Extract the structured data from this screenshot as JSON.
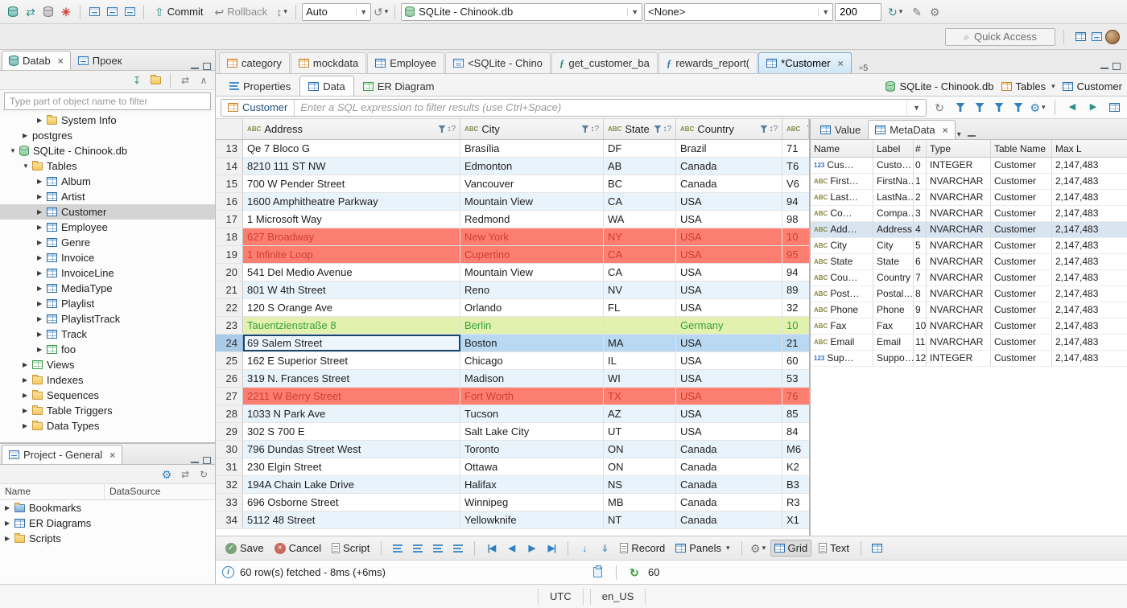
{
  "topbar": {
    "commit_label": "Commit",
    "rollback_label": "Rollback",
    "auto_value": "Auto",
    "datasource_value": "SQLite - Chinook.db",
    "schema_value": "<None>",
    "fetch_size": "200",
    "quick_access_label": "Quick Access"
  },
  "navigator": {
    "tab_database": "Datab",
    "tab_projects": "Проек",
    "filter_placeholder": "Type part of object name to filter",
    "tree": [
      {
        "label": "System Info",
        "indent": 46,
        "icon": "folder",
        "exp": "closed"
      },
      {
        "label": "postgres",
        "indent": 28,
        "icon": "none",
        "exp": "closed"
      },
      {
        "label": "SQLite - Chinook.db",
        "indent": 12,
        "icon": "db-green",
        "exp": "open"
      },
      {
        "label": "Tables",
        "indent": 28,
        "icon": "folder",
        "exp": "open"
      },
      {
        "label": "Album",
        "indent": 46,
        "icon": "table-blue",
        "exp": "closed"
      },
      {
        "label": "Artist",
        "indent": 46,
        "icon": "table-blue",
        "exp": "closed"
      },
      {
        "label": "Customer",
        "indent": 46,
        "icon": "table-blue",
        "exp": "closed",
        "selected": true
      },
      {
        "label": "Employee",
        "indent": 46,
        "icon": "table-blue",
        "exp": "closed"
      },
      {
        "label": "Genre",
        "indent": 46,
        "icon": "table-blue",
        "exp": "closed"
      },
      {
        "label": "Invoice",
        "indent": 46,
        "icon": "table-blue",
        "exp": "closed"
      },
      {
        "label": "InvoiceLine",
        "indent": 46,
        "icon": "table-blue",
        "exp": "closed"
      },
      {
        "label": "MediaType",
        "indent": 46,
        "icon": "table-blue",
        "exp": "closed"
      },
      {
        "label": "Playlist",
        "indent": 46,
        "icon": "table-blue",
        "exp": "closed"
      },
      {
        "label": "PlaylistTrack",
        "indent": 46,
        "icon": "table-blue",
        "exp": "closed"
      },
      {
        "label": "Track",
        "indent": 46,
        "icon": "table-blue",
        "exp": "closed"
      },
      {
        "label": "foo",
        "indent": 46,
        "icon": "table-green",
        "exp": "closed"
      },
      {
        "label": "Views",
        "indent": 28,
        "icon": "table-green",
        "exp": "closed"
      },
      {
        "label": "Indexes",
        "indent": 28,
        "icon": "folder",
        "exp": "closed"
      },
      {
        "label": "Sequences",
        "indent": 28,
        "icon": "folder",
        "exp": "closed"
      },
      {
        "label": "Table Triggers",
        "indent": 28,
        "icon": "folder",
        "exp": "closed"
      },
      {
        "label": "Data Types",
        "indent": 28,
        "icon": "folder",
        "exp": "closed"
      }
    ]
  },
  "project_panel": {
    "title": "Project - General",
    "col_name": "Name",
    "col_datasource": "DataSource",
    "items": [
      {
        "label": "Bookmarks",
        "icon": "folder-blue"
      },
      {
        "label": "ER Diagrams",
        "icon": "table-blue"
      },
      {
        "label": "Scripts",
        "icon": "folder"
      }
    ]
  },
  "editor": {
    "tabs": [
      {
        "label": "category",
        "icon": "table-orange"
      },
      {
        "label": "mockdata",
        "icon": "table-orange"
      },
      {
        "label": "Employee",
        "icon": "table-blue"
      },
      {
        "label": "<SQLite - Chino",
        "icon": "sql"
      },
      {
        "label": "get_customer_ba",
        "icon": "proc-teal"
      },
      {
        "label": "rewards_report(",
        "icon": "proc-blue"
      },
      {
        "label": "*Customer",
        "icon": "table-blue",
        "active": true,
        "close": true
      }
    ],
    "tab_overflow_count": "5",
    "subtabs": [
      {
        "label": "Properties"
      },
      {
        "label": "Data",
        "active": true
      },
      {
        "label": "ER Diagram"
      }
    ],
    "breadcrumb": {
      "datasource": "SQLite - Chinook.db",
      "container": "Tables",
      "entity": "Customer"
    },
    "filter": {
      "entity": "Customer",
      "placeholder": "Enter a SQL expression to filter results (use Ctrl+Space)"
    }
  },
  "grid": {
    "sort_hint": "↕?",
    "columns": [
      {
        "label": "Address"
      },
      {
        "label": "City"
      },
      {
        "label": "State"
      },
      {
        "label": "Country"
      },
      {
        "label": ""
      }
    ],
    "rows": [
      {
        "num": "13",
        "address": "Qe 7 Bloco G",
        "city": "Brasília",
        "state": "DF",
        "country": "Brazil",
        "postal": "71",
        "style": "w"
      },
      {
        "num": "14",
        "address": "8210 111 ST NW",
        "city": "Edmonton",
        "state": "AB",
        "country": "Canada",
        "postal": "T6",
        "style": "a"
      },
      {
        "num": "15",
        "address": "700 W Pender Street",
        "city": "Vancouver",
        "state": "BC",
        "country": "Canada",
        "postal": "V6",
        "style": "w"
      },
      {
        "num": "16",
        "address": "1600 Amphitheatre Parkway",
        "city": "Mountain View",
        "state": "CA",
        "country": "USA",
        "postal": "94",
        "style": "a"
      },
      {
        "num": "17",
        "address": "1 Microsoft Way",
        "city": "Redmond",
        "state": "WA",
        "country": "USA",
        "postal": "98",
        "style": "w"
      },
      {
        "num": "18",
        "address": "627 Broadway",
        "city": "New York",
        "state": "NY",
        "country": "USA",
        "postal": "10",
        "style": "red"
      },
      {
        "num": "19",
        "address": "1 Infinite Loop",
        "city": "Cupertino",
        "state": "CA",
        "country": "USA",
        "postal": "95",
        "style": "red"
      },
      {
        "num": "20",
        "address": "541 Del Medio Avenue",
        "city": "Mountain View",
        "state": "CA",
        "country": "USA",
        "postal": "94",
        "style": "w"
      },
      {
        "num": "21",
        "address": "801 W 4th Street",
        "city": "Reno",
        "state": "NV",
        "country": "USA",
        "postal": "89",
        "style": "a"
      },
      {
        "num": "22",
        "address": "120 S Orange Ave",
        "city": "Orlando",
        "state": "FL",
        "country": "USA",
        "postal": "32",
        "style": "w"
      },
      {
        "num": "23",
        "address": "Tauentzienstraße 8",
        "city": "Berlin",
        "state": "",
        "country": "Germany",
        "postal": "10",
        "style": "green"
      },
      {
        "num": "24",
        "address": "69 Salem Street",
        "city": "Boston",
        "state": "MA",
        "country": "USA",
        "postal": "21",
        "style": "sel",
        "selected_cell": "address"
      },
      {
        "num": "25",
        "address": "162 E Superior Street",
        "city": "Chicago",
        "state": "IL",
        "country": "USA",
        "postal": "60",
        "style": "w"
      },
      {
        "num": "26",
        "address": "319 N. Frances Street",
        "city": "Madison",
        "state": "WI",
        "country": "USA",
        "postal": "53",
        "style": "a"
      },
      {
        "num": "27",
        "address": "2211 W Berry Street",
        "city": "Fort Worth",
        "state": "TX",
        "country": "USA",
        "postal": "76",
        "style": "red"
      },
      {
        "num": "28",
        "address": "1033 N Park Ave",
        "city": "Tucson",
        "state": "AZ",
        "country": "USA",
        "postal": "85",
        "style": "a"
      },
      {
        "num": "29",
        "address": "302 S 700 E",
        "city": "Salt Lake City",
        "state": "UT",
        "country": "USA",
        "postal": "84",
        "style": "w"
      },
      {
        "num": "30",
        "address": "796 Dundas Street West",
        "city": "Toronto",
        "state": "ON",
        "country": "Canada",
        "postal": "M6",
        "style": "a"
      },
      {
        "num": "31",
        "address": "230 Elgin Street",
        "city": "Ottawa",
        "state": "ON",
        "country": "Canada",
        "postal": "K2",
        "style": "w"
      },
      {
        "num": "32",
        "address": "194A Chain Lake Drive",
        "city": "Halifax",
        "state": "NS",
        "country": "Canada",
        "postal": "B3",
        "style": "a"
      },
      {
        "num": "33",
        "address": "696 Osborne Street",
        "city": "Winnipeg",
        "state": "MB",
        "country": "Canada",
        "postal": "R3",
        "style": "w"
      },
      {
        "num": "34",
        "address": "5112 48 Street",
        "city": "Yellowknife",
        "state": "NT",
        "country": "Canada",
        "postal": "X1",
        "style": "a"
      }
    ]
  },
  "meta_panel": {
    "tab_value": "Value",
    "tab_metadata": "MetaData",
    "badges": {
      "abc": "ABC",
      "num": "123"
    },
    "columns": [
      "Name",
      "Label",
      "#",
      "Type",
      "Table Name",
      "Max L"
    ],
    "rows": [
      {
        "kind": "num",
        "name": "Cus…",
        "label": "Custo…",
        "idx": "0",
        "type": "INTEGER",
        "table": "Customer",
        "maxl": "2,147,483"
      },
      {
        "kind": "abc",
        "name": "First…",
        "label": "FirstNa…",
        "idx": "1",
        "type": "NVARCHAR",
        "table": "Customer",
        "maxl": "2,147,483"
      },
      {
        "kind": "abc",
        "name": "Last…",
        "label": "LastNa…",
        "idx": "2",
        "type": "NVARCHAR",
        "table": "Customer",
        "maxl": "2,147,483"
      },
      {
        "kind": "abc",
        "name": "Co…",
        "label": "Compa…",
        "idx": "3",
        "type": "NVARCHAR",
        "table": "Customer",
        "maxl": "2,147,483"
      },
      {
        "kind": "abc",
        "name": "Add…",
        "label": "Address",
        "idx": "4",
        "type": "NVARCHAR",
        "table": "Customer",
        "maxl": "2,147,483",
        "selected": true
      },
      {
        "kind": "abc",
        "name": "City",
        "label": "City",
        "idx": "5",
        "type": "NVARCHAR",
        "table": "Customer",
        "maxl": "2,147,483"
      },
      {
        "kind": "abc",
        "name": "State",
        "label": "State",
        "idx": "6",
        "type": "NVARCHAR",
        "table": "Customer",
        "maxl": "2,147,483"
      },
      {
        "kind": "abc",
        "name": "Cou…",
        "label": "Country",
        "idx": "7",
        "type": "NVARCHAR",
        "table": "Customer",
        "maxl": "2,147,483"
      },
      {
        "kind": "abc",
        "name": "Post…",
        "label": "Postal…",
        "idx": "8",
        "type": "NVARCHAR",
        "table": "Customer",
        "maxl": "2,147,483"
      },
      {
        "kind": "abc",
        "name": "Phone",
        "label": "Phone",
        "idx": "9",
        "type": "NVARCHAR",
        "table": "Customer",
        "maxl": "2,147,483"
      },
      {
        "kind": "abc",
        "name": "Fax",
        "label": "Fax",
        "idx": "10",
        "type": "NVARCHAR",
        "table": "Customer",
        "maxl": "2,147,483"
      },
      {
        "kind": "abc",
        "name": "Email",
        "label": "Email",
        "idx": "11",
        "type": "NVARCHAR",
        "table": "Customer",
        "maxl": "2,147,483"
      },
      {
        "kind": "num",
        "name": "Sup…",
        "label": "Suppo…",
        "idx": "12",
        "type": "INTEGER",
        "table": "Customer",
        "maxl": "2,147,483"
      }
    ]
  },
  "editor_toolbar": {
    "save": "Save",
    "cancel": "Cancel",
    "script": "Script",
    "record": "Record",
    "panels": "Panels",
    "grid": "Grid",
    "text": "Text"
  },
  "status": {
    "fetched": "60 row(s) fetched - 8ms (+6ms)",
    "refresh_count": "60"
  },
  "app_status": {
    "timezone": "UTC",
    "locale": "en_US"
  }
}
